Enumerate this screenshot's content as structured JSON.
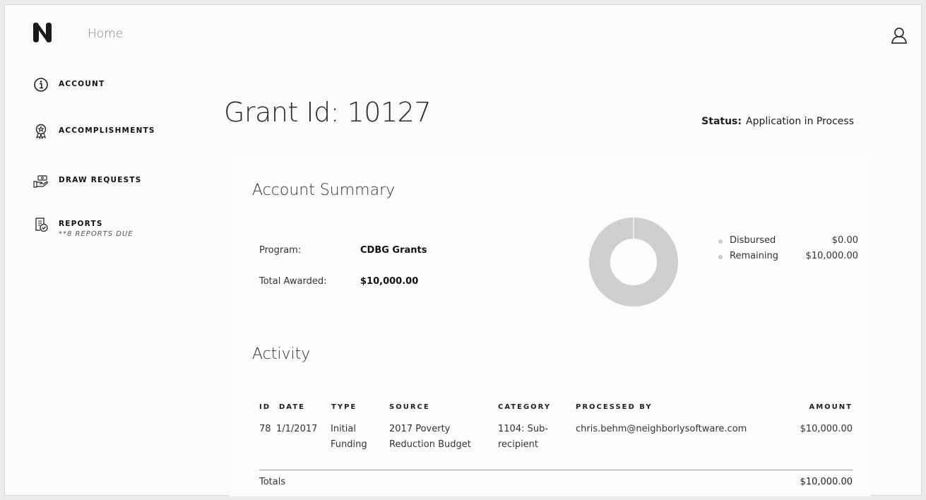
{
  "header": {
    "home_label": "Home"
  },
  "sidebar": {
    "items": [
      {
        "label": "ACCOUNT",
        "icon": "info-icon"
      },
      {
        "label": "ACCOMPLISHMENTS",
        "icon": "award-icon"
      },
      {
        "label": "DRAW REQUESTS",
        "icon": "money-hand-icon"
      },
      {
        "label": "REPORTS",
        "sub": "**8 REPORTS DUE",
        "icon": "report-check-icon"
      }
    ]
  },
  "main": {
    "title": "Grant Id: 10127",
    "status_label": "Status:",
    "status_value": "Application in Process"
  },
  "summary": {
    "title": "Account Summary",
    "program_label": "Program:",
    "program_value": "CDBG Grants",
    "awarded_label": "Total Awarded:",
    "awarded_value": "$10,000.00",
    "legend": [
      {
        "name": "Disbursed",
        "value": "$0.00"
      },
      {
        "name": "Remaining",
        "value": "$10,000.00"
      }
    ],
    "disbursed_fraction": 0.0,
    "colors": {
      "donut": "#cfcfcf",
      "legend_dot": "#cccccc"
    }
  },
  "activity": {
    "title": "Activity",
    "columns": [
      "ID",
      "DATE",
      "TYPE",
      "SOURCE",
      "CATEGORY",
      "PROCESSED BY",
      "AMOUNT"
    ],
    "rows": [
      {
        "id": "78",
        "date": "1/1/2017",
        "type_line1": "Initial",
        "type_line2": "Funding",
        "source_line1": "2017 Poverty",
        "source_line2": "Reduction Budget",
        "category_line1": "1104: Sub-",
        "category_line2": "recipient",
        "processed_by": "chris.behm@neighborlysoftware.com",
        "amount": "$10,000.00"
      }
    ],
    "totals_label": "Totals",
    "totals_value": "$10,000.00"
  }
}
